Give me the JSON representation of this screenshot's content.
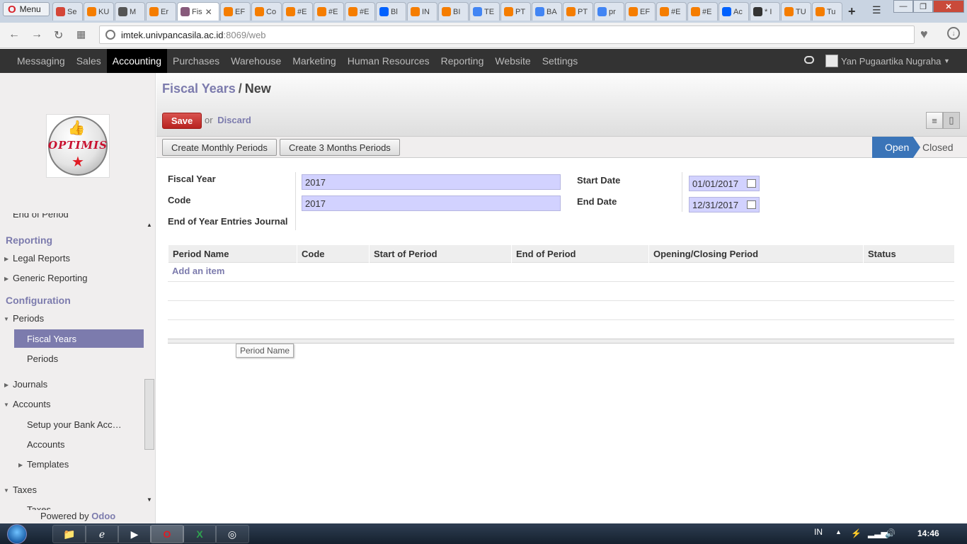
{
  "browser": {
    "menu_label": "Menu",
    "tabs": [
      {
        "label": "Se",
        "color": "#d44638"
      },
      {
        "label": "KU",
        "color": "#f57d00"
      },
      {
        "label": "M",
        "color": "#555555"
      },
      {
        "label": "Er",
        "color": "#f57d00"
      },
      {
        "label": "Fis",
        "color": "#875a7b",
        "active": true
      },
      {
        "label": "EF",
        "color": "#f57d00"
      },
      {
        "label": "Co",
        "color": "#f57d00"
      },
      {
        "label": "#E",
        "color": "#f57d00"
      },
      {
        "label": "#E",
        "color": "#f57d00"
      },
      {
        "label": "#E",
        "color": "#f57d00"
      },
      {
        "label": "Bl",
        "color": "#0061fe"
      },
      {
        "label": "IN",
        "color": "#f57d00"
      },
      {
        "label": "BI",
        "color": "#f57d00"
      },
      {
        "label": "TE",
        "color": "#4285f4"
      },
      {
        "label": "PT",
        "color": "#f57d00"
      },
      {
        "label": "BA",
        "color": "#4285f4"
      },
      {
        "label": "PT",
        "color": "#f57d00"
      },
      {
        "label": "pr",
        "color": "#4285f4"
      },
      {
        "label": "EF",
        "color": "#f57d00"
      },
      {
        "label": "#E",
        "color": "#f57d00"
      },
      {
        "label": "#E",
        "color": "#f57d00"
      },
      {
        "label": "Ac",
        "color": "#0061fe"
      },
      {
        "label": "* I",
        "color": "#333333"
      },
      {
        "label": "TU",
        "color": "#f57d00"
      },
      {
        "label": "Tu",
        "color": "#f57d00"
      }
    ],
    "url_host": "imtek.univpancasila.ac.id",
    "url_path": ":8069/web"
  },
  "topnav": {
    "items": [
      "Messaging",
      "Sales",
      "Accounting",
      "Purchases",
      "Warehouse",
      "Marketing",
      "Human Resources",
      "Reporting",
      "Website",
      "Settings"
    ],
    "active": "Accounting",
    "user_name": "Yan Pugaartika Nugraha"
  },
  "sidebar": {
    "logo_text": "OPTIMIS",
    "cut_item": "End of Period",
    "reporting_header": "Reporting",
    "legal_reports": "Legal Reports",
    "generic_reporting": "Generic Reporting",
    "configuration_header": "Configuration",
    "periods_group": "Periods",
    "fiscal_years": "Fiscal Years",
    "periods": "Periods",
    "journals": "Journals",
    "accounts_group": "Accounts",
    "setup_bank": "Setup your Bank Acc…",
    "accounts": "Accounts",
    "templates": "Templates",
    "taxes_group": "Taxes",
    "taxes_cut": "Taxes",
    "powered_by": "Powered by",
    "odoo": "Odoo"
  },
  "form": {
    "breadcrumb_parent": "Fiscal Years",
    "breadcrumb_sep": "/",
    "breadcrumb_current": "New",
    "save_label": "Save",
    "or_label": "or",
    "discard_label": "Discard",
    "btn_monthly": "Create Monthly Periods",
    "btn_3months": "Create 3 Months Periods",
    "status_open": "Open",
    "status_closed": "Closed",
    "fiscal_year_label": "Fiscal Year",
    "fiscal_year_value": "2017",
    "code_label": "Code",
    "code_value": "2017",
    "eoy_label": "End of Year Entries Journal",
    "start_date_label": "Start Date",
    "start_date_value": "01/01/2017",
    "end_date_label": "End Date",
    "end_date_value": "12/31/2017",
    "table": {
      "columns": [
        "Period Name",
        "Code",
        "Start of Period",
        "End of Period",
        "Opening/Closing Period",
        "Status"
      ],
      "add_item": "Add an item"
    },
    "tooltip": "Period Name"
  },
  "taskbar": {
    "lang": "IN",
    "time": "14:46"
  }
}
